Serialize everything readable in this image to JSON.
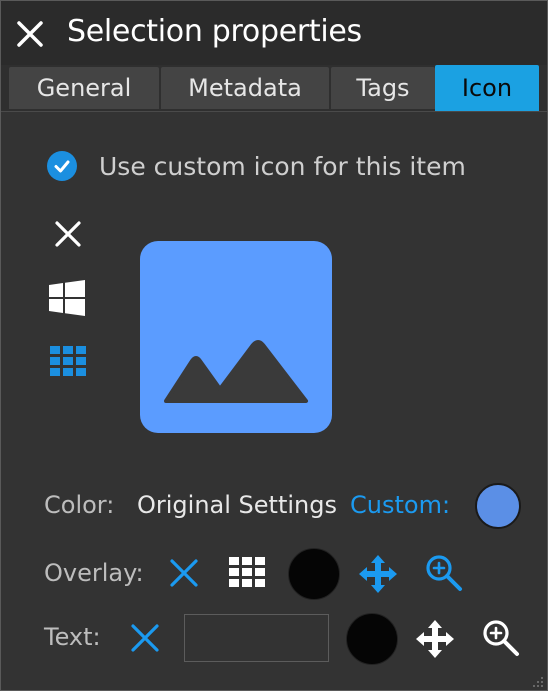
{
  "window": {
    "title": "Selection properties"
  },
  "tabs": [
    {
      "label": "General",
      "active": false
    },
    {
      "label": "Metadata",
      "active": false
    },
    {
      "label": "Tags",
      "active": false
    },
    {
      "label": "Icon",
      "active": true
    }
  ],
  "custom_icon": {
    "checkbox_label": "Use custom icon for this item",
    "checked": true
  },
  "icon_options": [
    "close-icon",
    "windows-logo-icon",
    "grid-icon"
  ],
  "preview": {
    "icon": "image-mountains-icon",
    "color": "#5b9cff"
  },
  "color_row": {
    "label": "Color:",
    "original": "Original Settings",
    "custom": "Custom:",
    "swatch_color": "#5b8fe6"
  },
  "overlay_row": {
    "label": "Overlay:"
  },
  "text_row": {
    "label": "Text:",
    "input_value": ""
  },
  "colors": {
    "accent": "#1ba1e2",
    "link": "#1b9af0",
    "panel_bg": "#333333"
  }
}
